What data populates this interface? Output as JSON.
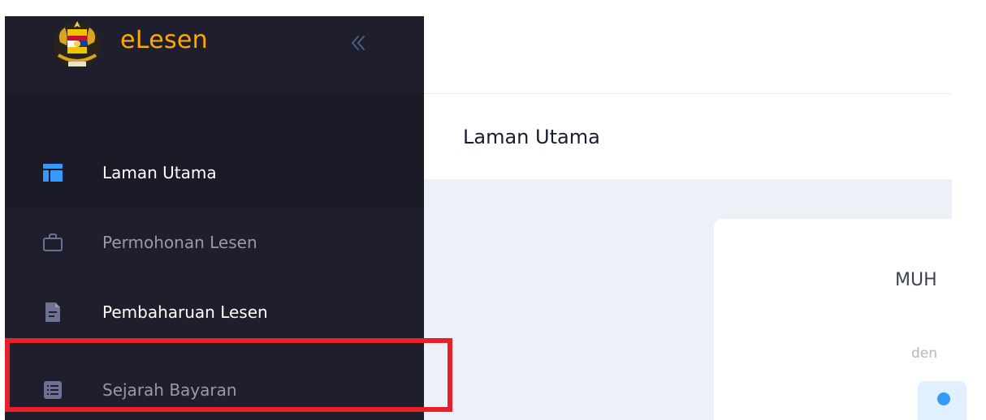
{
  "app": {
    "brand_name": "eLesen",
    "logo_icon": "malaysia-coat-of-arms-logo",
    "accent_color": "#ffa800",
    "sidebar_bg": "#1e1e2d"
  },
  "sidebar": {
    "collapse_icon": "chevrons-left-icon",
    "items": [
      {
        "label": "Laman Utama",
        "icon": "dashboard-layout-icon",
        "state": "active"
      },
      {
        "label": "Permohonan Lesen",
        "icon": "briefcase-icon",
        "state": "normal"
      },
      {
        "label": "Pembaharuan Lesen",
        "icon": "document-icon",
        "state": "normal"
      },
      {
        "label": "Sejarah Bayaran",
        "icon": "list-icon",
        "state": "highlighted"
      }
    ]
  },
  "main": {
    "page_title": "Laman Utama",
    "card": {
      "name_fragment": "MUH",
      "subtitle_fragment": "den"
    }
  },
  "annotation": {
    "highlight_color": "#e8202a"
  }
}
